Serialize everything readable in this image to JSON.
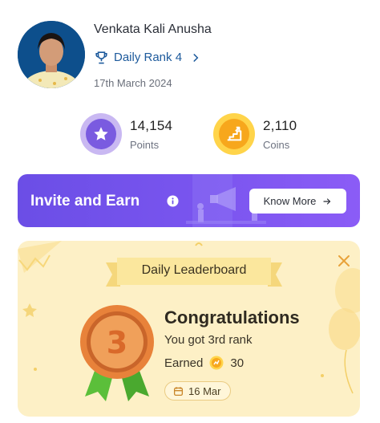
{
  "profile": {
    "name": "Venkata Kali Anusha",
    "rank_label": "Daily Rank 4",
    "date": "17th March 2024"
  },
  "stats": {
    "points": {
      "value": "14,154",
      "label": "Points"
    },
    "coins": {
      "value": "2,110",
      "label": "Coins"
    }
  },
  "invite": {
    "title": "Invite and Earn",
    "button_label": "Know More"
  },
  "leaderboard": {
    "title": "Daily Leaderboard",
    "medal_rank": "3",
    "congrats": "Congratulations",
    "rank_text": "You got 3rd rank",
    "earned_label": "Earned",
    "earned_value": "30",
    "date": "16 Mar"
  },
  "colors": {
    "accent_purple": "#7a55ef",
    "link_blue": "#1d5a9c",
    "card_yellow": "#fdf0c6",
    "medal_orange": "#e8823a",
    "ribbon_green": "#5bbf3a"
  },
  "icons": [
    "trophy-icon",
    "chevron-right-icon",
    "star-icon",
    "stairs-icon",
    "info-icon",
    "arrow-right-icon",
    "close-icon",
    "coin-icon",
    "calendar-icon",
    "medal-icon"
  ]
}
